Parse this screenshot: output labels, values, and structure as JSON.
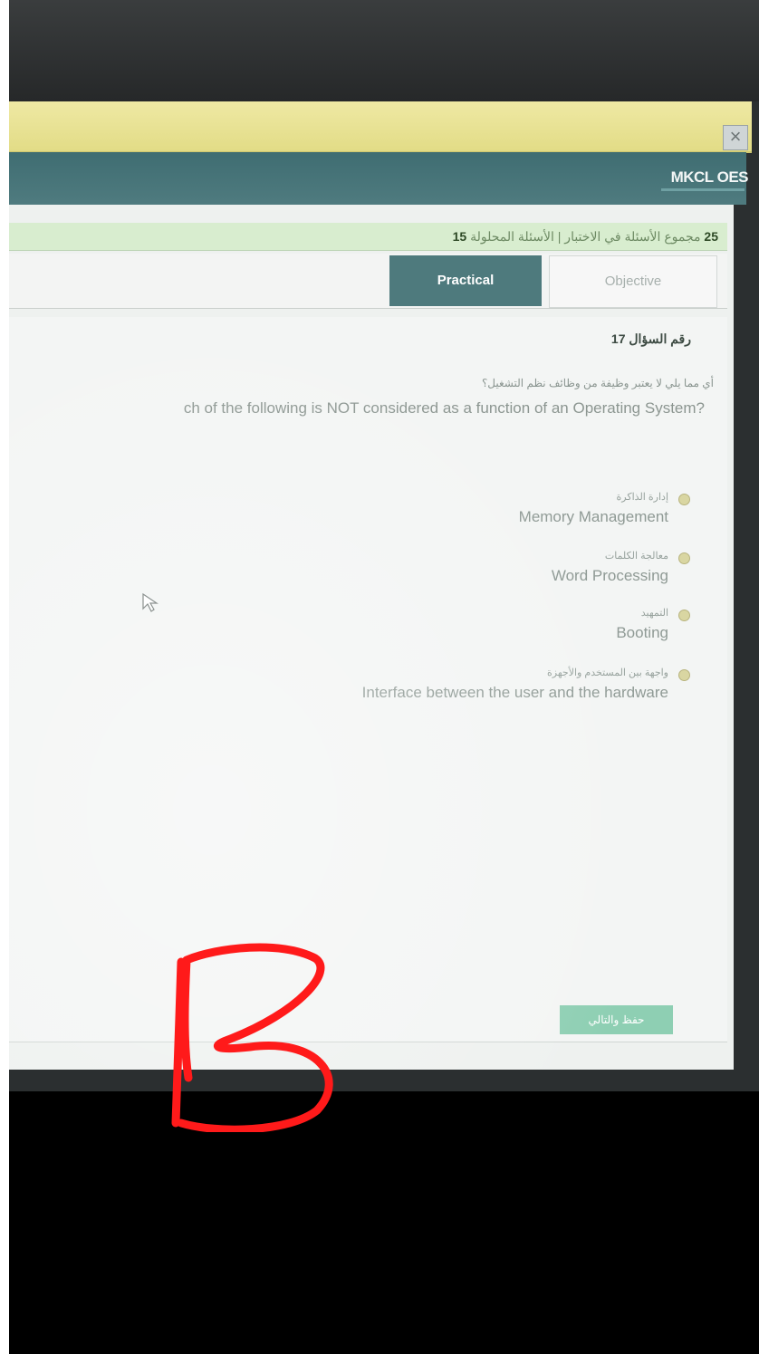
{
  "header": {
    "close_glyph": "×",
    "brand": "MKCL OES"
  },
  "status": {
    "count_total": "25",
    "text": "مجموع الأسئلة في الاختبار | الأسئلة المحلولة",
    "count_answered": "15"
  },
  "tabs": [
    {
      "label": "Practical",
      "active": true
    },
    {
      "label": "Objective",
      "active": false
    }
  ],
  "question": {
    "number_label": "رقم السؤال 17",
    "arabic_text": "أي مما يلي لا يعتبر وظيفة من وظائف نظم التشغيل؟",
    "english_text": "ch of the following is NOT considered as a function of an Operating System?"
  },
  "options": [
    {
      "arabic": "إدارة الذاكرة",
      "english": "Memory Management"
    },
    {
      "arabic": "معالجة الكلمات",
      "english": "Word Processing"
    },
    {
      "arabic": "التمهيد",
      "english": "Booting"
    },
    {
      "arabic": "واجهة بين المستخدم والأجهزة",
      "english": "Interface between the user and the hardware"
    }
  ],
  "submit_label": "حفظ والتالي",
  "annotation": {
    "letter": "B",
    "color": "#ff1a1a"
  },
  "colors": {
    "title_bar": "#e8e29a",
    "header_bar": "#47747a",
    "active_tab": "#4e7a7d",
    "submit": "#8ecfb3"
  }
}
